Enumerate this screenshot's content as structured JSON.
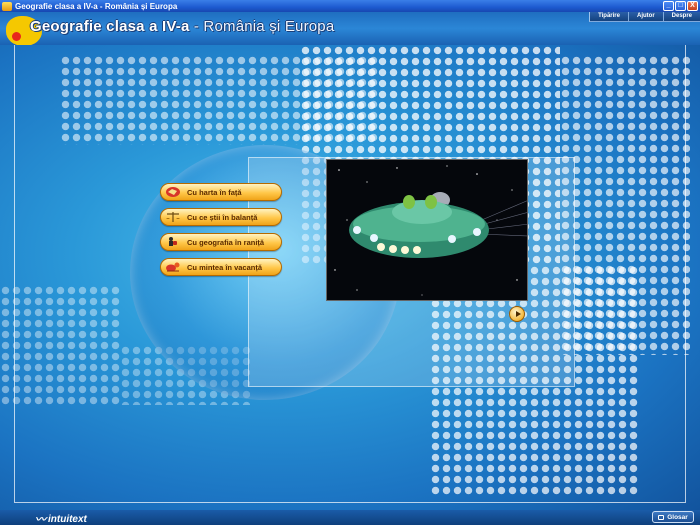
{
  "window": {
    "title": "Geografie clasa a IV-a - România și Europa",
    "buttons": [
      "_",
      "□",
      "X"
    ]
  },
  "header": {
    "title_main": "Geografie clasa a IV-a",
    "title_sep": " - ",
    "title_sub": "România și Europa",
    "nav": [
      "Tipărire",
      "Ajutor",
      "Despre"
    ]
  },
  "menu": {
    "items": [
      {
        "label": "Cu harta în față",
        "icon": "map-icon"
      },
      {
        "label": "Cu ce știi în balanță",
        "icon": "scales-icon"
      },
      {
        "label": "Cu geografia în raniță",
        "icon": "backpack-icon"
      },
      {
        "label": "Cu mintea în vacanță",
        "icon": "vacation-icon"
      }
    ]
  },
  "video": {
    "content": "ufo-animation"
  },
  "footer": {
    "brand": "intuitext",
    "glossary_label": "Glosar"
  },
  "colors": {
    "titlebar": "#1d5ad0",
    "header": "#2b86d6",
    "button_orange": "#ffc84a",
    "background": "#2a98d8",
    "footer": "#0e3f7c"
  }
}
